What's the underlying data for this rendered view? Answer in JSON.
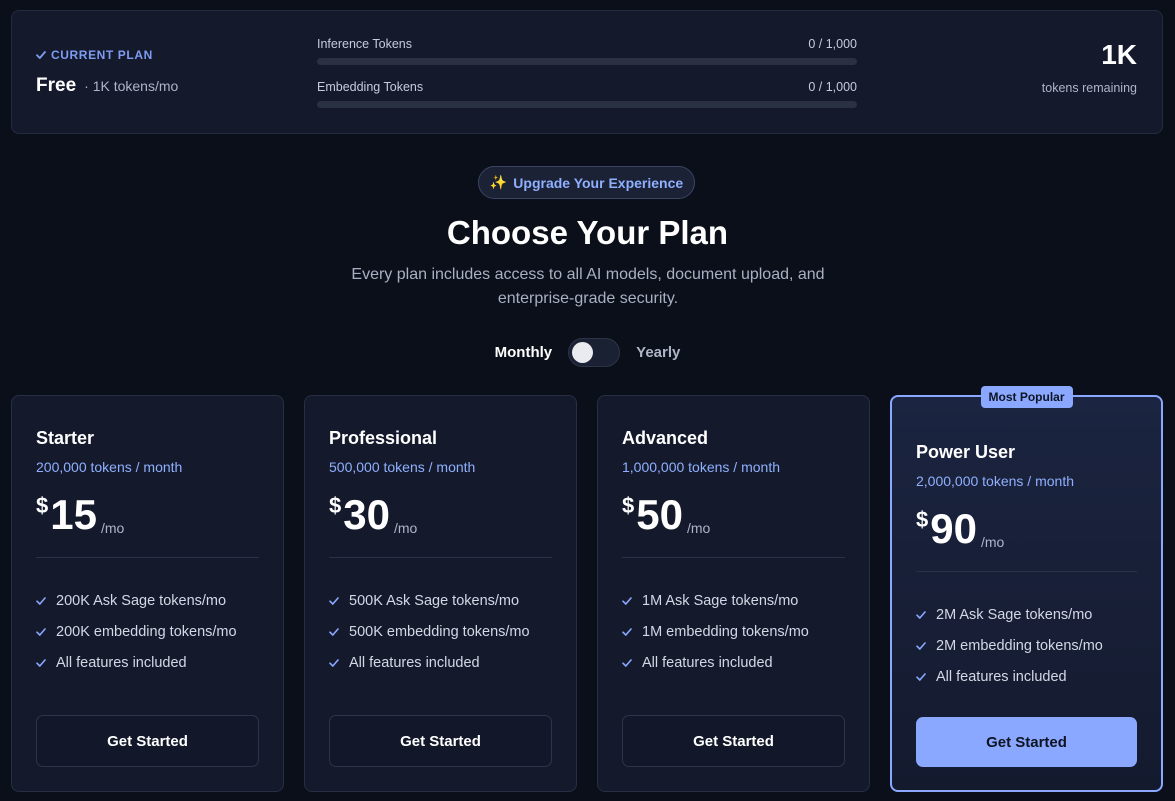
{
  "current_plan": {
    "tag": "CURRENT PLAN",
    "name": "Free",
    "subtitle": "· 1K tokens/mo",
    "usage": [
      {
        "label": "Inference Tokens",
        "value": "0 / 1,000",
        "fraction": 0
      },
      {
        "label": "Embedding Tokens",
        "value": "0 / 1,000",
        "fraction": 0
      }
    ],
    "remaining_value": "1K",
    "remaining_label": "tokens remaining"
  },
  "hero": {
    "pill": "Upgrade Your Experience",
    "pill_icon": "✨",
    "title": "Choose Your Plan",
    "subtitle": "Every plan includes access to all AI models, document upload, and enterprise-grade security."
  },
  "billing": {
    "monthly_label": "Monthly",
    "yearly_label": "Yearly",
    "yearly_selected": false
  },
  "colors": {
    "accent": "#8aa8ff",
    "background": "#0b0f19",
    "card": "#141a2c"
  },
  "plans": [
    {
      "name": "Starter",
      "tokens": "200,000 tokens / month",
      "currency": "$",
      "price": "15",
      "period": "/mo",
      "features": [
        "200K Ask Sage tokens/mo",
        "200K embedding tokens/mo",
        "All features included"
      ],
      "cta": "Get Started"
    },
    {
      "name": "Professional",
      "tokens": "500,000 tokens / month",
      "currency": "$",
      "price": "30",
      "period": "/mo",
      "features": [
        "500K Ask Sage tokens/mo",
        "500K embedding tokens/mo",
        "All features included"
      ],
      "cta": "Get Started"
    },
    {
      "name": "Advanced",
      "tokens": "1,000,000 tokens / month",
      "currency": "$",
      "price": "50",
      "period": "/mo",
      "features": [
        "1M Ask Sage tokens/mo",
        "1M embedding tokens/mo",
        "All features included"
      ],
      "cta": "Get Started"
    },
    {
      "name": "Power User",
      "tokens": "2,000,000 tokens / month",
      "currency": "$",
      "price": "90",
      "period": "/mo",
      "features": [
        "2M Ask Sage tokens/mo",
        "2M embedding tokens/mo",
        "All features included"
      ],
      "cta": "Get Started",
      "badge": "Most Popular"
    }
  ]
}
